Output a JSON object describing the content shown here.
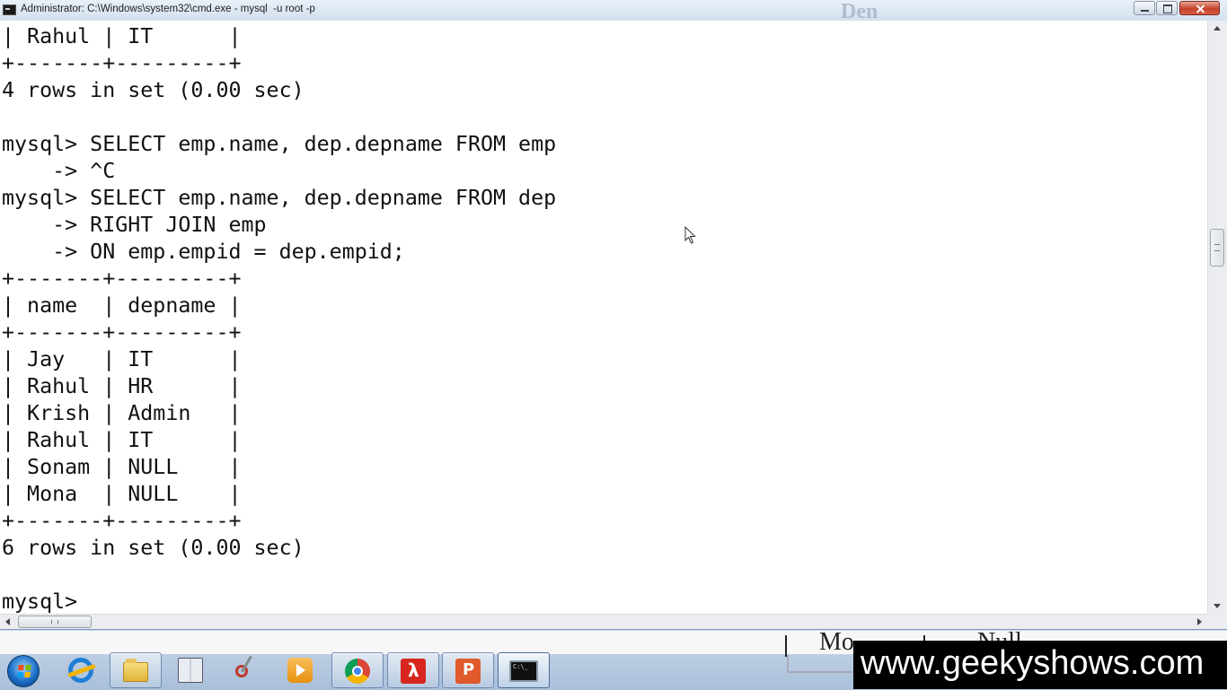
{
  "window": {
    "title": "Administrator: C:\\Windows\\system32\\cmd.exe - mysql  -u root -p",
    "background_ghost_text": "Den"
  },
  "console": {
    "lines": [
      "| Rahul | IT      |",
      "+-------+---------+",
      "4 rows in set (0.00 sec)",
      "",
      "mysql> SELECT emp.name, dep.depname FROM emp",
      "    -> ^C",
      "mysql> SELECT emp.name, dep.depname FROM dep",
      "    -> RIGHT JOIN emp",
      "    -> ON emp.empid = dep.empid;",
      "+-------+---------+",
      "| name  | depname |",
      "+-------+---------+",
      "| Jay   | IT      |",
      "| Rahul | HR      |",
      "| Krish | Admin   |",
      "| Rahul | IT      |",
      "| Sonam | NULL    |",
      "| Mona  | NULL    |",
      "+-------+---------+",
      "6 rows in set (0.00 sec)",
      "",
      "mysql>"
    ]
  },
  "background_window": {
    "fragment_1": "Mo",
    "fragment_2": "Null"
  },
  "taskbar": {
    "items": [
      {
        "icon": "internet-explorer-icon"
      },
      {
        "icon": "file-explorer-icon"
      },
      {
        "icon": "reader-book-icon"
      },
      {
        "icon": "snipping-tool-icon"
      },
      {
        "icon": "media-player-icon"
      },
      {
        "icon": "chrome-icon"
      },
      {
        "icon": "acrobat-pdf-icon"
      },
      {
        "icon": "powerpoint-icon"
      },
      {
        "icon": "command-prompt-icon"
      }
    ]
  },
  "watermark": {
    "text": "www.geekyshows.com"
  },
  "colors": {
    "console_background": "#ffffff",
    "console_text": "#111111",
    "close_button": "#c7422c",
    "watermark_background": "#000000"
  }
}
